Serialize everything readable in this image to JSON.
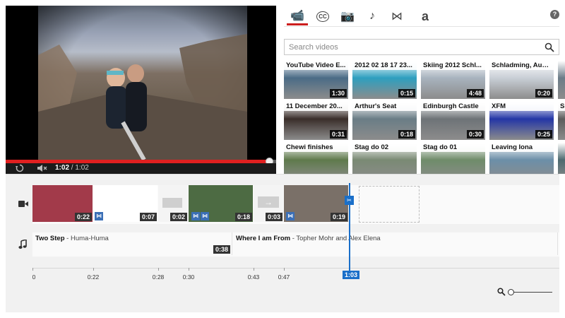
{
  "player": {
    "time_current": "1:02",
    "time_separator": "/",
    "time_total": "1:02",
    "progress_fraction": 0.975
  },
  "tabs": [
    {
      "name": "video-camera-icon",
      "glyph": "📹",
      "active": true
    },
    {
      "name": "closed-captions-icon",
      "glyph": "CC",
      "active": false
    },
    {
      "name": "photo-camera-icon",
      "glyph": "📷",
      "active": false
    },
    {
      "name": "music-note-icon",
      "glyph": "♪",
      "active": false
    },
    {
      "name": "transitions-icon",
      "glyph": "⋈",
      "active": false
    },
    {
      "name": "text-icon",
      "glyph": "a",
      "active": false
    }
  ],
  "help_label": "?",
  "search": {
    "placeholder": "Search videos"
  },
  "thumbnails": [
    {
      "title": "YouTube Video E...",
      "duration": "1:30",
      "color": "#4a6b86"
    },
    {
      "title": "2012 02 18 17 23...",
      "duration": "0:15",
      "color": "#2e9fbf"
    },
    {
      "title": "Skiing 2012 Schl...",
      "duration": "4:48",
      "color": "#a8b3be"
    },
    {
      "title": "Schladming, Aust...",
      "duration": "0:20",
      "color": "#c9cfd6"
    },
    {
      "title": "",
      "duration": "",
      "color": "#6b7c88"
    },
    {
      "title": "11 December 20...",
      "duration": "0:31",
      "color": "#3a2e2a"
    },
    {
      "title": "Arthur's Seat",
      "duration": "0:18",
      "color": "#6a7d86"
    },
    {
      "title": "Edinburgh Castle",
      "duration": "0:30",
      "color": "#6e7377"
    },
    {
      "title": "XFM",
      "duration": "0:25",
      "color": "#2436a6"
    },
    {
      "title": "Su",
      "duration": "",
      "color": "#5c5c5c"
    },
    {
      "title": "Chewi finishes",
      "duration": "",
      "color": "#5f7a4c"
    },
    {
      "title": "Stag do 02",
      "duration": "",
      "color": "#7a8a74"
    },
    {
      "title": "Stag do 01",
      "duration": "",
      "color": "#6f8c6a"
    },
    {
      "title": "Leaving Iona",
      "duration": "",
      "color": "#6c8fa8"
    },
    {
      "title": "",
      "duration": "",
      "color": "#4d6a70"
    }
  ],
  "timeline": {
    "clips": [
      {
        "name": "clip-crowd",
        "duration": "0:22",
        "color": "#a23a4a"
      },
      {
        "name": "clip-white-fade",
        "duration": "0:07",
        "color": "#ffffff"
      },
      {
        "name": "clip-gray-box",
        "duration": "0:02",
        "color": "#f4f4f4"
      },
      {
        "name": "clip-forest-path",
        "duration": "0:18",
        "color": "#4d6b43"
      },
      {
        "name": "clip-arrows",
        "duration": "0:03",
        "color": "#f4f4f4"
      },
      {
        "name": "clip-selfie",
        "duration": "0:19",
        "color": "#7a7068"
      }
    ],
    "audio": [
      {
        "song": "Two Step",
        "separator": " - ",
        "artist": "Huma-Huma",
        "duration": "0:38"
      },
      {
        "song": "Where I am From",
        "separator": " - ",
        "artist": "Topher Mohr and Alex Elena",
        "duration": ""
      }
    ],
    "ruler_labels": [
      "0",
      "0:22",
      "0:28",
      "0:30",
      "0:43",
      "0:47",
      "1:03"
    ],
    "playhead_time": "1:03",
    "zoom_fraction": 0.05
  },
  "colors": {
    "accent_red": "#cc1e1e",
    "playhead_blue": "#1a6fc9"
  }
}
